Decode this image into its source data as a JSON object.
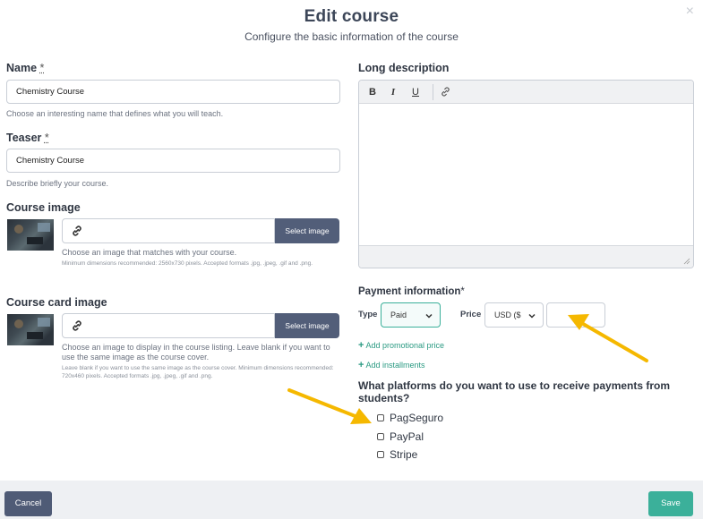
{
  "modal": {
    "title": "Edit course",
    "subtitle": "Configure the basic information of the course",
    "close": "×"
  },
  "name": {
    "label": "Name",
    "required_mark": "*",
    "value": "Chemistry Course",
    "help": "Choose an interesting name that defines what you will teach."
  },
  "teaser": {
    "label": "Teaser",
    "required_mark": "*",
    "value": "Chemistry Course",
    "help": "Describe briefly your course."
  },
  "course_image": {
    "label": "Course image",
    "button": "Select image",
    "help": "Choose an image that matches with your course.",
    "help_small": "Minimum dimensions recommended: 2560x730 pixels. Accepted formats .jpg, .jpeg, .gif and .png."
  },
  "card_image": {
    "label": "Course card image",
    "button": "Select image",
    "help": "Choose an image to display in the course listing. Leave blank if you want to use the same image as the course cover.",
    "help_small": "Leave blank if you want to use the same image as the course cover. Minimum dimensions recommended: 720x460 pixels. Accepted formats .jpg, .jpeg, .gif and .png."
  },
  "long_description": {
    "label": "Long description",
    "toolbar": {
      "bold": "B",
      "italic": "I",
      "underline": "U"
    }
  },
  "payment": {
    "label": "Payment information",
    "required_mark": "*",
    "type_label": "Type",
    "type_value": "Paid",
    "price_label": "Price",
    "currency_value": "USD ($",
    "price_value": "",
    "add_promo": "Add promotional price",
    "add_installments": "Add installments"
  },
  "platforms": {
    "question": "What platforms do you want to use to receive payments from students?",
    "options": [
      "PagSeguro",
      "PayPal",
      "Stripe"
    ]
  },
  "footer": {
    "cancel": "Cancel",
    "save": "Save"
  },
  "colors": {
    "primary_dark": "#525e79",
    "accent_green": "#3bb09a",
    "annotation_arrow": "#f5b800"
  }
}
